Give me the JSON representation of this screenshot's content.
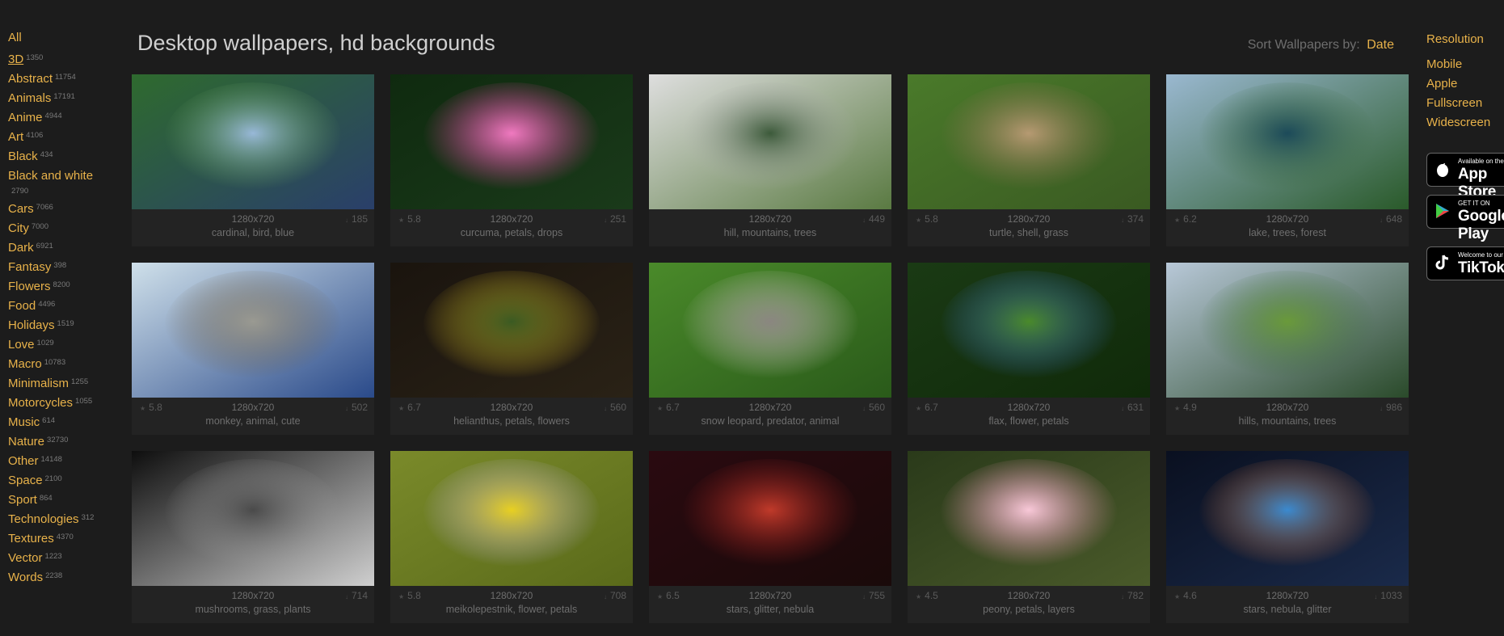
{
  "header": {
    "title": "Desktop wallpapers, hd backgrounds",
    "sort_label": "Sort Wallpapers by:",
    "sort_value": "Date"
  },
  "sidebar": {
    "all": "All",
    "categories": [
      {
        "label": "3D",
        "count": "1350"
      },
      {
        "label": "Abstract",
        "count": "11754"
      },
      {
        "label": "Animals",
        "count": "17191"
      },
      {
        "label": "Anime",
        "count": "4944"
      },
      {
        "label": "Art",
        "count": "4106"
      },
      {
        "label": "Black",
        "count": "434"
      },
      {
        "label": "Black and white",
        "count": "2790"
      },
      {
        "label": "Cars",
        "count": "7066"
      },
      {
        "label": "City",
        "count": "7000"
      },
      {
        "label": "Dark",
        "count": "6921"
      },
      {
        "label": "Fantasy",
        "count": "398"
      },
      {
        "label": "Flowers",
        "count": "8200"
      },
      {
        "label": "Food",
        "count": "4496"
      },
      {
        "label": "Holidays",
        "count": "1519"
      },
      {
        "label": "Love",
        "count": "1029"
      },
      {
        "label": "Macro",
        "count": "10783"
      },
      {
        "label": "Minimalism",
        "count": "1255"
      },
      {
        "label": "Motorcycles",
        "count": "1055"
      },
      {
        "label": "Music",
        "count": "614"
      },
      {
        "label": "Nature",
        "count": "32730"
      },
      {
        "label": "Other",
        "count": "14148"
      },
      {
        "label": "Space",
        "count": "2100"
      },
      {
        "label": "Sport",
        "count": "864"
      },
      {
        "label": "Technologies",
        "count": "312"
      },
      {
        "label": "Textures",
        "count": "4370"
      },
      {
        "label": "Vector",
        "count": "1223"
      },
      {
        "label": "Words",
        "count": "2238"
      }
    ]
  },
  "right": {
    "title": "Resolution",
    "items": [
      "Mobile",
      "Apple",
      "Fullscreen",
      "Widescreen"
    ],
    "stores": [
      {
        "small": "Available on the",
        "large": "App Store"
      },
      {
        "small": "GET IT ON",
        "large": "Google Play"
      },
      {
        "small": "Welcome to our",
        "large": "TikTok"
      }
    ]
  },
  "wallpapers": [
    {
      "tags": "cardinal, bird, blue",
      "resolution": "1280x720",
      "rating": "",
      "downloads": "185",
      "colors": [
        "#2e6a2e",
        "#6aa65a",
        "#98b8d8",
        "#2a3f6a"
      ]
    },
    {
      "tags": "curcuma, petals, drops",
      "resolution": "1280x720",
      "rating": "5.8",
      "downloads": "251",
      "colors": [
        "#0f2a0f",
        "#d83a9a",
        "#f07ac0",
        "#1a3a1a"
      ]
    },
    {
      "tags": "hill, mountains, trees",
      "resolution": "1280x720",
      "rating": "",
      "downloads": "449",
      "colors": [
        "#dedede",
        "#b0b0b0",
        "#3c5a3a",
        "#5a7a42"
      ]
    },
    {
      "tags": "turtle, shell, grass",
      "resolution": "1280x720",
      "rating": "5.8",
      "downloads": "374",
      "colors": [
        "#4a7a2a",
        "#8a7050",
        "#b69a72",
        "#3a5a22"
      ]
    },
    {
      "tags": "lake, trees, forest",
      "resolution": "1280x720",
      "rating": "6.2",
      "downloads": "648",
      "colors": [
        "#9ab8d0",
        "#3a6a3a",
        "#1c4a5a",
        "#2a5a2a"
      ]
    },
    {
      "tags": "monkey, animal, cute",
      "resolution": "1280x720",
      "rating": "5.8",
      "downloads": "502",
      "colors": [
        "#cfe0ea",
        "#6a5a40",
        "#9a9a92",
        "#2a4a8a"
      ]
    },
    {
      "tags": "helianthus, petals, flowers",
      "resolution": "1280x720",
      "rating": "6.7",
      "downloads": "560",
      "colors": [
        "#1a140e",
        "#e8c020",
        "#3a5a22",
        "#2a2216"
      ]
    },
    {
      "tags": "snow leopard, predator, animal",
      "resolution": "1280x720",
      "rating": "6.7",
      "downloads": "560",
      "colors": [
        "#4a8a2a",
        "#cfcac2",
        "#8a8680",
        "#2a5a1a"
      ]
    },
    {
      "tags": "flax, flower, petals",
      "resolution": "1280x720",
      "rating": "6.7",
      "downloads": "631",
      "colors": [
        "#1a3a14",
        "#3a6ad0",
        "#4a8a2a",
        "#102a0a"
      ]
    },
    {
      "tags": "hills, mountains, trees",
      "resolution": "1280x720",
      "rating": "4.9",
      "downloads": "986",
      "colors": [
        "#b8c8d8",
        "#3a6a3a",
        "#6a9a3a",
        "#2a4a2a"
      ]
    },
    {
      "tags": "mushrooms, grass, plants",
      "resolution": "1280x720",
      "rating": "",
      "downloads": "714",
      "colors": [
        "#0e0e0e",
        "#9a9a9a",
        "#4a4a4a",
        "#cfcfcf"
      ]
    },
    {
      "tags": "meikolepestnik, flower, petals",
      "resolution": "1280x720",
      "rating": "5.8",
      "downloads": "708",
      "colors": [
        "#7a8a2a",
        "#b8aef0",
        "#e8d020",
        "#5a6a1a"
      ]
    },
    {
      "tags": "stars, glitter, nebula",
      "resolution": "1280x720",
      "rating": "6.5",
      "downloads": "755",
      "colors": [
        "#2a0a10",
        "#8a1a1a",
        "#c03a2a",
        "#1a0a0a"
      ]
    },
    {
      "tags": "peony, petals, layers",
      "resolution": "1280x720",
      "rating": "4.5",
      "downloads": "782",
      "colors": [
        "#2a3a1a",
        "#e890b0",
        "#f8c8d8",
        "#4a5a2a"
      ]
    },
    {
      "tags": "stars, nebula, glitter",
      "resolution": "1280x720",
      "rating": "4.6",
      "downloads": "1033",
      "colors": [
        "#0a1020",
        "#d06a2a",
        "#3a8ad0",
        "#1a2a4a"
      ]
    }
  ]
}
